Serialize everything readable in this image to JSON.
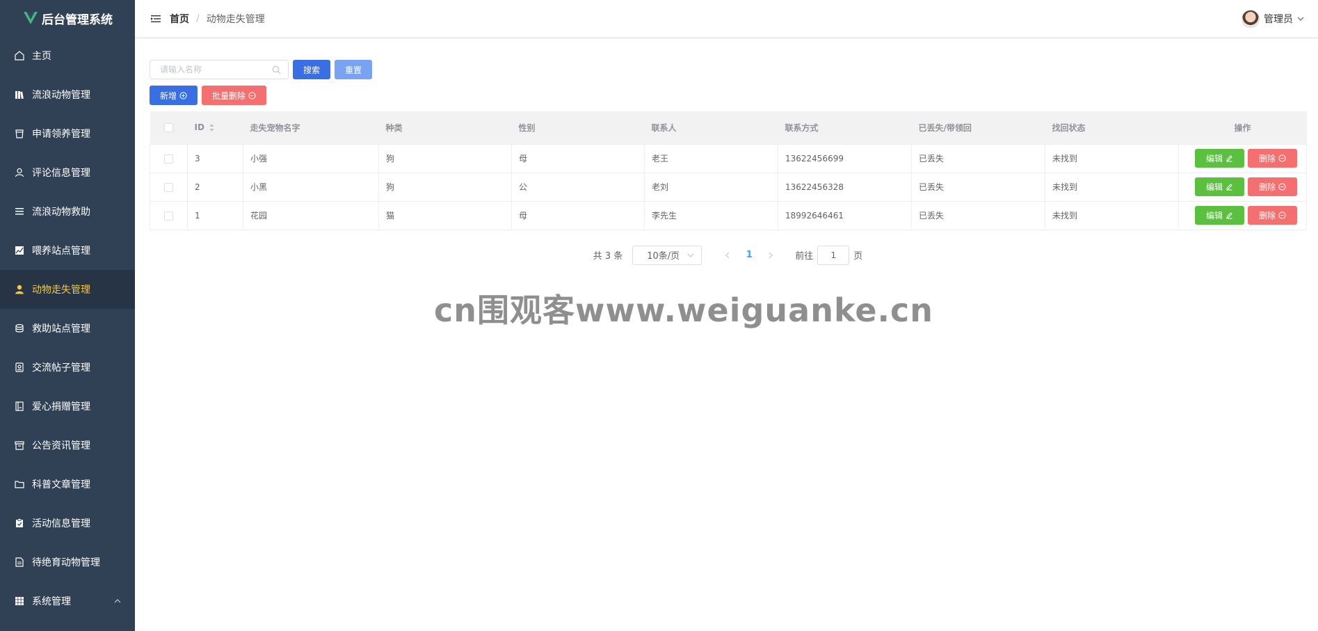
{
  "app": {
    "title": "后台管理系统"
  },
  "sidebar": {
    "items": [
      {
        "label": "主页",
        "icon": "home-icon"
      },
      {
        "label": "流浪动物管理",
        "icon": "library-icon"
      },
      {
        "label": "申请领养管理",
        "icon": "cup-icon"
      },
      {
        "label": "评论信息管理",
        "icon": "user-icon"
      },
      {
        "label": "流浪动物救助",
        "icon": "list-icon"
      },
      {
        "label": "喂养站点管理",
        "icon": "chart-icon"
      },
      {
        "label": "动物走失管理",
        "icon": "user-solid-icon",
        "active": true
      },
      {
        "label": "救助站点管理",
        "icon": "coin-icon"
      },
      {
        "label": "交流帖子管理",
        "icon": "badge-icon"
      },
      {
        "label": "爱心捐赠管理",
        "icon": "notebook-icon"
      },
      {
        "label": "公告资讯管理",
        "icon": "box-icon"
      },
      {
        "label": "科普文章管理",
        "icon": "folder-icon"
      },
      {
        "label": "活动信息管理",
        "icon": "clipboard-icon"
      },
      {
        "label": "待绝育动物管理",
        "icon": "document-icon"
      },
      {
        "label": "系统管理",
        "icon": "grid-icon"
      }
    ]
  },
  "header": {
    "breadcrumb_home": "首页",
    "breadcrumb_current": "动物走失管理",
    "user_name": "管理员"
  },
  "toolbar": {
    "search_placeholder": "请输入名称",
    "search_label": "搜索",
    "reset_label": "重置",
    "add_label": "新增",
    "batch_delete_label": "批量删除"
  },
  "table": {
    "headers": [
      "ID",
      "走失宠物名字",
      "种类",
      "性别",
      "联系人",
      "联系方式",
      "已丢失/带领回",
      "找回状态",
      "操作"
    ],
    "edit_label": "编辑",
    "delete_label": "删除",
    "rows": [
      {
        "id": "3",
        "name": "小强",
        "type": "狗",
        "sex": "母",
        "contact": "老王",
        "phone": "13622456699",
        "lost": "已丢失",
        "status": "未找到"
      },
      {
        "id": "2",
        "name": "小黑",
        "type": "狗",
        "sex": "公",
        "contact": "老刘",
        "phone": "13622456328",
        "lost": "已丢失",
        "status": "未找到"
      },
      {
        "id": "1",
        "name": "花园",
        "type": "猫",
        "sex": "母",
        "contact": "李先生",
        "phone": "18992646461",
        "lost": "已丢失",
        "status": "未找到"
      }
    ]
  },
  "pagination": {
    "total_text": "共 3 条",
    "page_size": "10条/页",
    "current_page": "1",
    "goto_prefix": "前往",
    "goto_value": "1",
    "goto_suffix": "页"
  },
  "watermark": "cn围观客www.weiguanke.cn",
  "colors": {
    "sidebar_bg": "#304156",
    "active_text": "#f6ca3c",
    "primary": "#3a6fe4",
    "danger": "#f46f6f",
    "success": "#5bbf3f"
  }
}
